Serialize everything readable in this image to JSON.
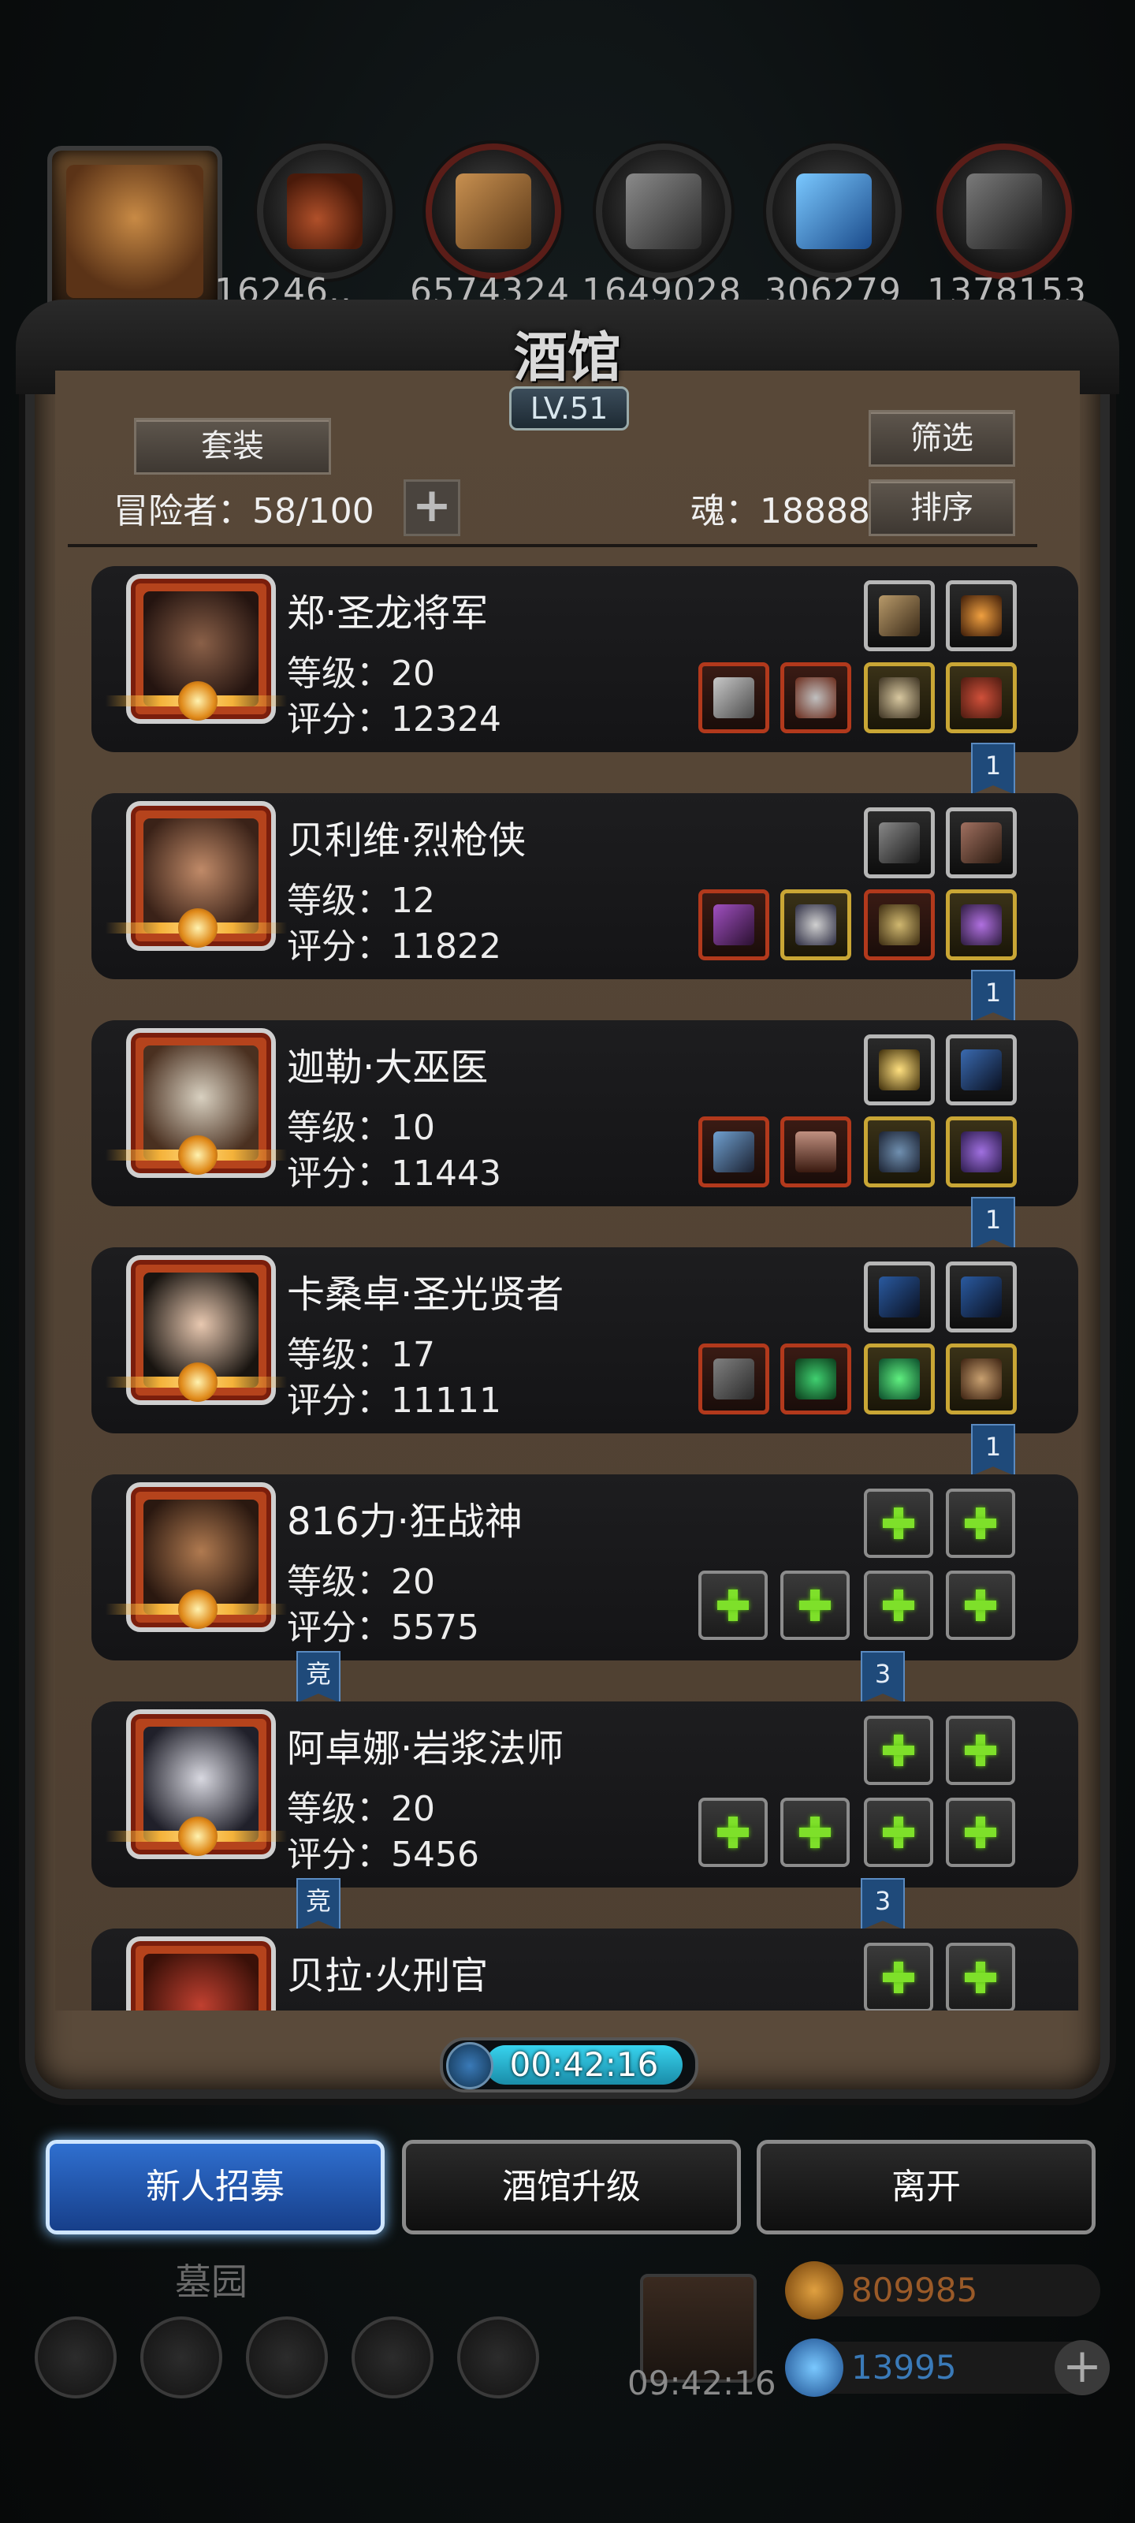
{
  "top_bar": {
    "resources": [
      {
        "name": "meat",
        "value": "16246..",
        "color": "#8a3a1a"
      },
      {
        "name": "wood",
        "value": "6574324",
        "color": "#9a6a30"
      },
      {
        "name": "stone",
        "value": "1649028",
        "color": "#6a6a6a"
      },
      {
        "name": "crystal",
        "value": "306279",
        "color": "#2a7ac0"
      },
      {
        "name": "iron",
        "value": "1378153",
        "color": "#5a5a5a"
      }
    ]
  },
  "panel": {
    "title": "酒馆",
    "level": "LV.51",
    "set_button": "套装",
    "filter_button": "筛选",
    "sort_button": "排序",
    "adventurers_label": "冒险者：58/100",
    "soul_label": "魂：18888"
  },
  "heroes": [
    {
      "name": "郑·圣龙将军",
      "level": "等级：20",
      "score": "评分：12324",
      "tag_right": "1",
      "tag_left": ""
    },
    {
      "name": "贝利维·烈枪侠",
      "level": "等级：12",
      "score": "评分：11822",
      "tag_right": "1",
      "tag_left": ""
    },
    {
      "name": "迦勒·大巫医",
      "level": "等级：10",
      "score": "评分：11443",
      "tag_right": "1",
      "tag_left": ""
    },
    {
      "name": "卡桑卓·圣光贤者",
      "level": "等级：17",
      "score": "评分：11111",
      "tag_right": "1",
      "tag_left": ""
    },
    {
      "name": "816力·狂战神",
      "level": "等级：20",
      "score": "评分：5575",
      "tag_right": "3",
      "tag_left": "竞"
    },
    {
      "name": "阿卓娜·岩浆法师",
      "level": "等级：20",
      "score": "评分：5456",
      "tag_right": "3",
      "tag_left": "竞"
    },
    {
      "name": "贝拉·火刑官",
      "level": "",
      "score": "",
      "tag_right": "",
      "tag_left": ""
    }
  ],
  "timer": "00:42:16",
  "buttons": {
    "recruit": "新人招募",
    "upgrade": "酒馆升级",
    "leave": "离开"
  },
  "hud": {
    "graveyard": "墓园",
    "gift_timer": "09:42:16",
    "gold": "809985",
    "gems": "13995"
  }
}
